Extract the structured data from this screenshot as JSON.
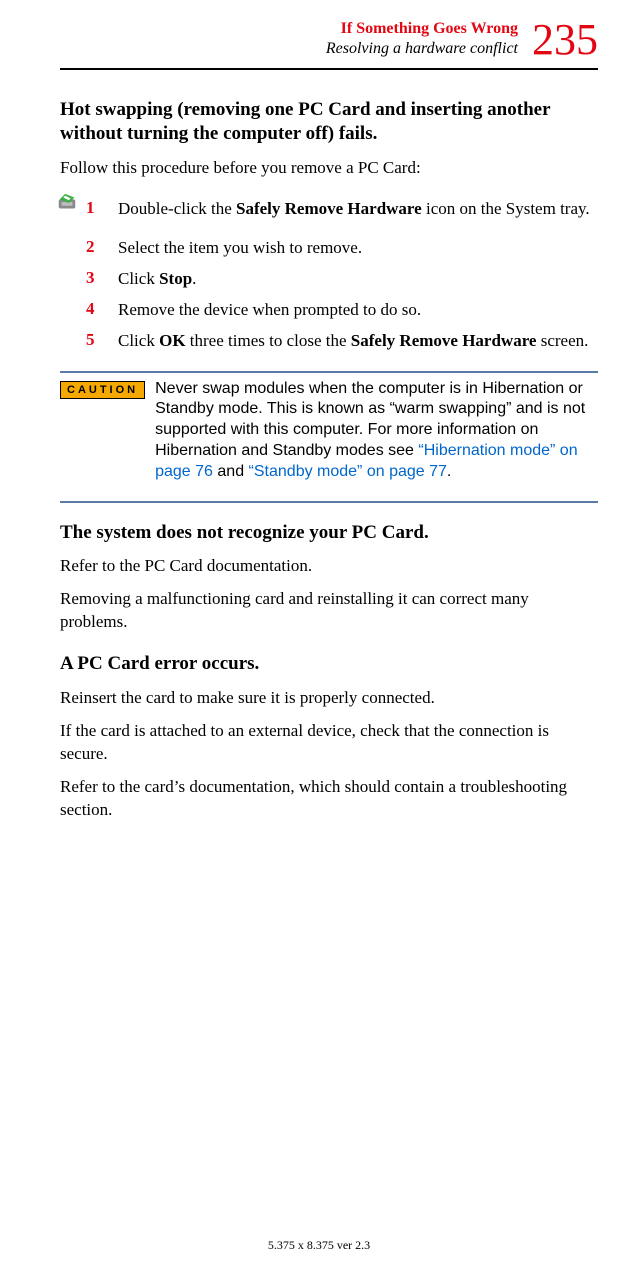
{
  "header": {
    "chapter": "If Something Goes Wrong",
    "section": "Resolving a hardware conflict",
    "page_number": "235"
  },
  "sec1": {
    "heading": "Hot swapping (removing one PC Card and inserting another without turning the computer off) fails",
    "intro": "Follow this procedure before you remove a PC Card:",
    "steps": {
      "s1": {
        "num": "1",
        "pre": "Double-click the ",
        "bold": "Safely Remove Hardware",
        "post": " icon on the System tray."
      },
      "s2": {
        "num": "2",
        "text": "Select the item you wish to remove."
      },
      "s3": {
        "num": "3",
        "pre": "Click ",
        "bold": "Stop",
        "post": "."
      },
      "s4": {
        "num": "4",
        "text": "Remove the device when prompted to do so."
      },
      "s5": {
        "num": "5",
        "pre": "Click ",
        "bold1": "OK",
        "mid": " three times to close the ",
        "bold2": "Safely Remove Hardware",
        "post": " screen."
      }
    }
  },
  "caution": {
    "label": "CAUTION",
    "pre": "Never swap modules when the computer is in Hibernation or Standby mode. This is known as “warm swapping” and is not supported with this computer. For more information on Hibernation and Standby modes see ",
    "link1": "“Hibernation mode” on page 76",
    "mid": " and ",
    "link2": "“Standby mode” on page 77",
    "post": "."
  },
  "sec2": {
    "heading": "The system does not recognize your PC Card",
    "p1": "Refer to the PC Card documentation.",
    "p2": "Removing a malfunctioning card and reinstalling it can correct many problems."
  },
  "sec3": {
    "heading": "A PC Card error occurs.",
    "p1": "Reinsert the card to make sure it is properly connected.",
    "p2": "If the card is attached to an external device, check that the connection is secure.",
    "p3": "Refer to the card’s documentation, which should contain a troubleshooting section."
  },
  "footer": "5.375 x 8.375 ver 2.3"
}
